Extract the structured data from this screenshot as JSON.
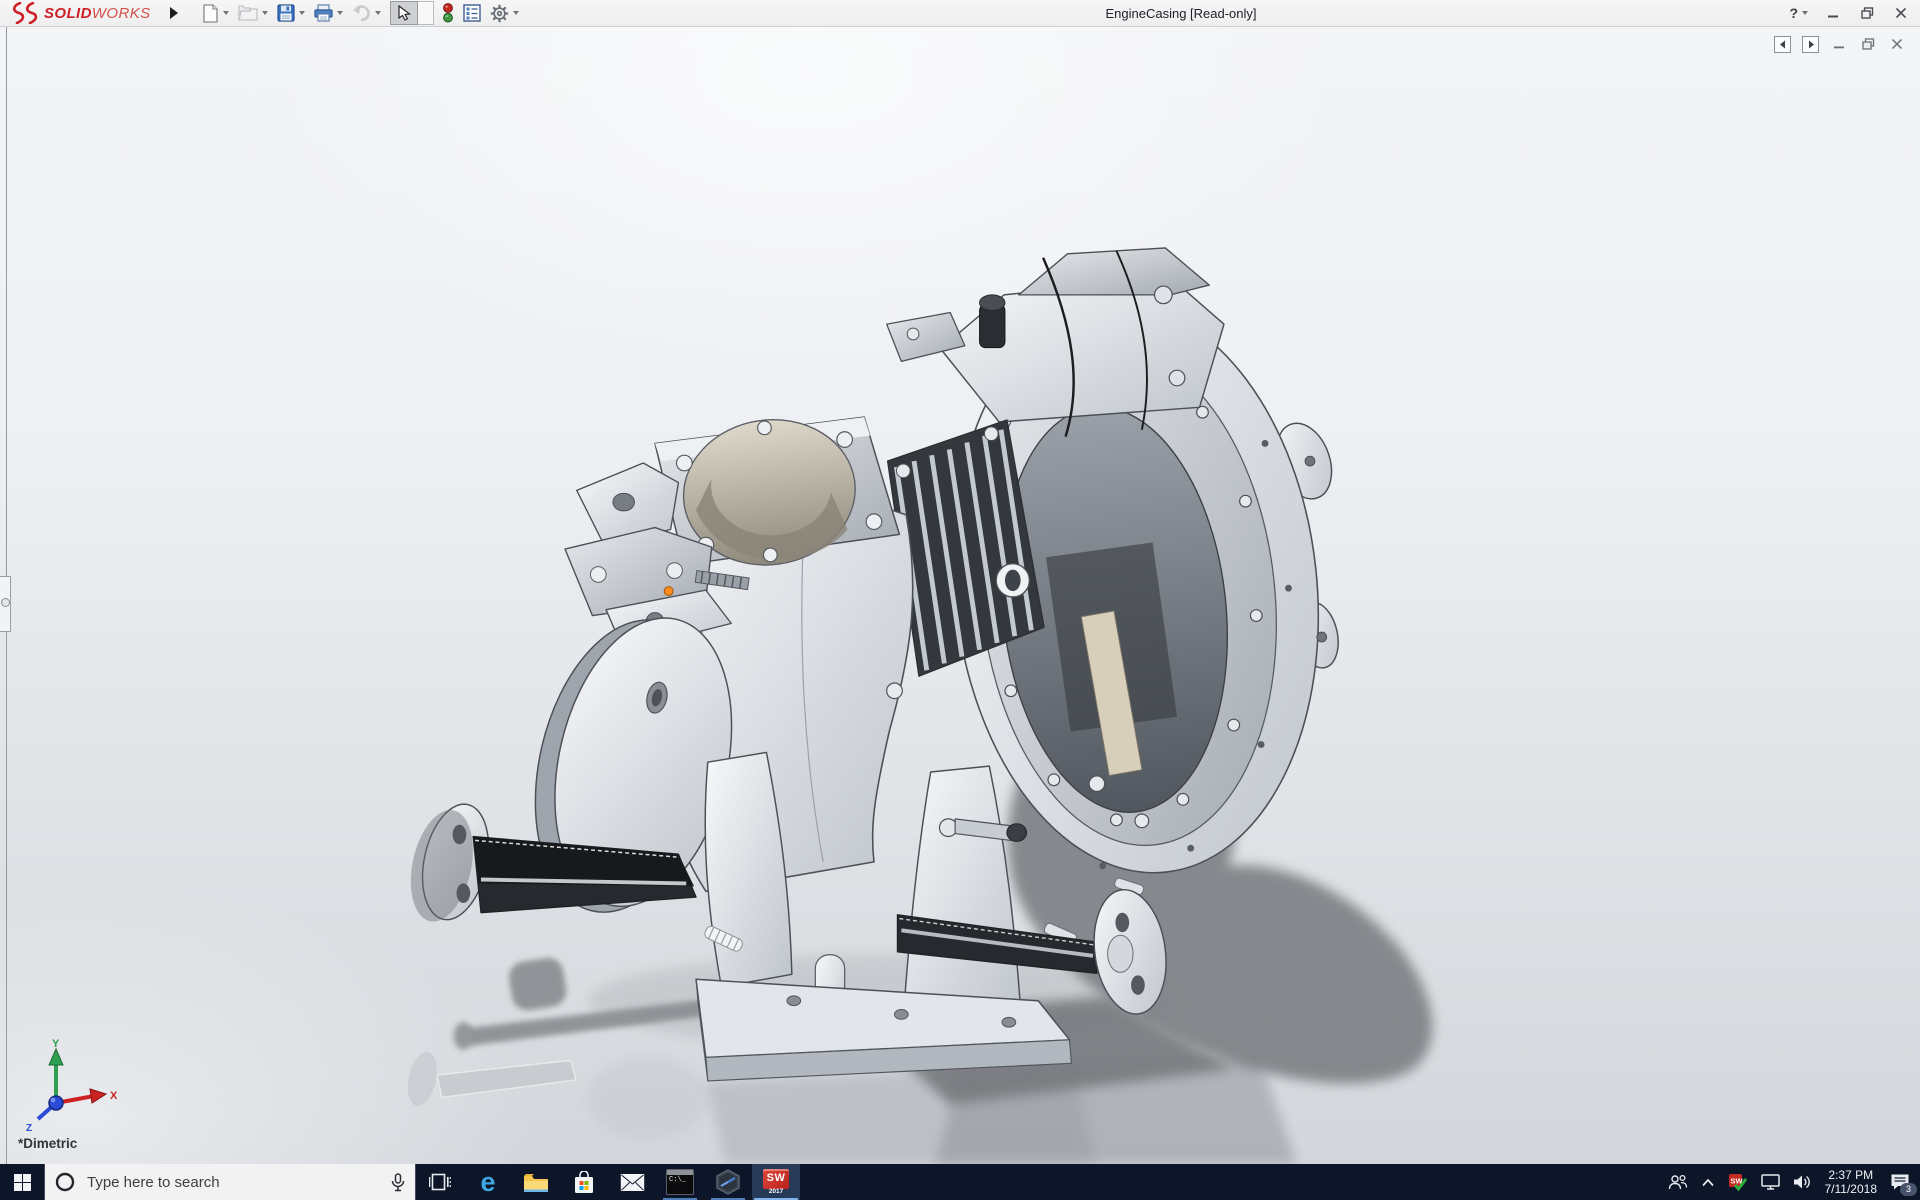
{
  "titlebar": {
    "logo_solid": "SOLID",
    "logo_works": "WORKS",
    "title": "EngineCasing [Read-only]",
    "help_label": "?"
  },
  "toolbar": {
    "buttons": [
      {
        "name": "new-document",
        "icon": "page-icon"
      },
      {
        "name": "open",
        "icon": "folder-icon"
      },
      {
        "name": "save",
        "icon": "floppy-icon"
      },
      {
        "name": "print",
        "icon": "printer-icon"
      },
      {
        "name": "undo",
        "icon": "undo-arrow-icon",
        "disabled": true
      },
      {
        "name": "select",
        "icon": "cursor-icon",
        "active": true
      },
      {
        "name": "rebuild",
        "icon": "traffic-light-icon"
      },
      {
        "name": "file-properties",
        "icon": "document-properties-icon"
      },
      {
        "name": "options",
        "icon": "gear-icon"
      }
    ]
  },
  "document_window": {
    "controls": [
      "nav-left",
      "nav-right",
      "minimize",
      "restore",
      "close"
    ]
  },
  "viewport": {
    "orientation_label": "*Dimetric",
    "triad": {
      "x_label": "X",
      "y_label": "Y",
      "z_label": "Z"
    },
    "origin_marker_color": "#ff8c1a",
    "model_name": "engine-casing-assembly"
  },
  "taskbar": {
    "search_placeholder": "Type here to search",
    "edge_letter": "e",
    "cmd_icon_text": "C:\\_",
    "sw_icon_text": "SW",
    "sw_icon_year": "2017",
    "apps": [
      "task-view",
      "edge",
      "file-explorer",
      "store",
      "mail",
      "command-prompt",
      "hexagon-app",
      "solidworks-2017"
    ],
    "tray": {
      "time": "2:37 PM",
      "date": "7/11/2018",
      "notification_count": "3"
    },
    "colors": {
      "taskbar_bg": "#0c1628",
      "active_underline": "#83b3ea",
      "running_underline": "#4f7fb8"
    }
  },
  "brand_colors": {
    "solidworks_red": "#cd2026"
  }
}
